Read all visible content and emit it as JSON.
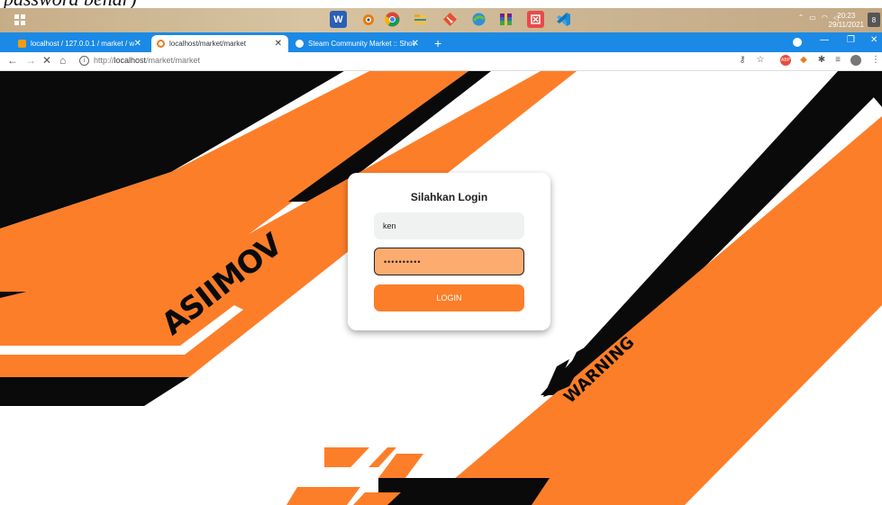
{
  "caption": {
    "text": "password benar)"
  },
  "taskbar": {
    "icons": [
      "windows-start-icon",
      "word-icon",
      "blender-icon",
      "chrome-icon",
      "file-explorer-icon",
      "git-icon",
      "xampp-icon",
      "winrar-icon",
      "red-app-icon",
      "vscode-icon"
    ],
    "time": "20:23",
    "date": "29/11/2021",
    "notification_count": "8"
  },
  "tabs": [
    {
      "label": "localhost / 127.0.0.1 / market / w",
      "active": false
    },
    {
      "label": "localhost/market/market",
      "active": true
    },
    {
      "label": "Steam Community Market :: Shov",
      "active": false
    }
  ],
  "address_bar": {
    "url_prefix": "http://",
    "url_host": "localhost",
    "url_path": "/market/market"
  },
  "login": {
    "title": "Silahkan Login",
    "username_value": "ken",
    "password_value": "••••••••••",
    "button_label": "LOGIN"
  },
  "background_text": {
    "brand": "ASIIMOV",
    "warning": "WARNING"
  },
  "colors": {
    "accent_orange": "#fd7e29",
    "password_fill": "#fdac70",
    "tab_bar_blue": "#1a8ae6",
    "black": "#0a0a0a"
  }
}
